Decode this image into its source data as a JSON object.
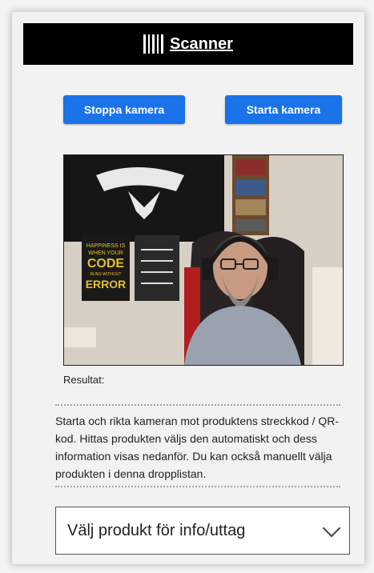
{
  "header": {
    "title": "Scanner",
    "icon": "barcode-icon"
  },
  "buttons": {
    "stop": "Stoppa kamera",
    "start": "Starta kamera"
  },
  "camera": {
    "poster_text": [
      "HAPPINESS IS",
      "WHEN YOUR",
      "CODE",
      "RUNS WITHOUT",
      "ERROR"
    ]
  },
  "result_label": "Resultat:",
  "description": "Starta och rikta kameran mot produktens streckkod / QR-kod. Hittas produkten väljs den automatiskt och dess information visas nedanför. Du kan också manuellt välja produkten i denna dropplistan.",
  "dropdown": {
    "selected": "Välj produkt för info/uttag"
  },
  "colors": {
    "header_bg": "#000000",
    "button_bg": "#1a73e8"
  }
}
